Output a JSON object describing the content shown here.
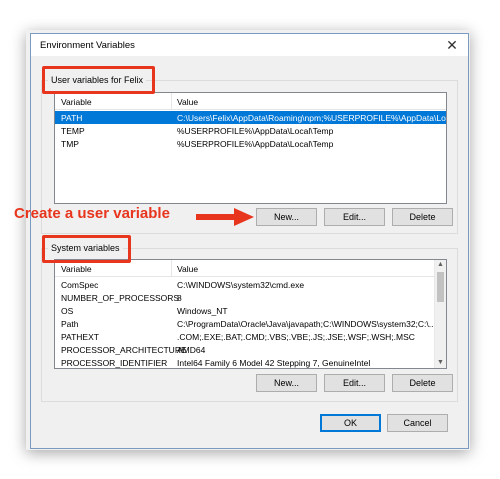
{
  "window": {
    "title": "Environment Variables",
    "close_glyph": "✕"
  },
  "user_group": {
    "label": "User variables for Felix",
    "columns": [
      "Variable",
      "Value"
    ],
    "rows": [
      {
        "variable": "PATH",
        "value": "C:\\Users\\Felix\\AppData\\Roaming\\npm;%USERPROFILE%\\AppData\\Lo...",
        "selected": true
      },
      {
        "variable": "TEMP",
        "value": "%USERPROFILE%\\AppData\\Local\\Temp",
        "selected": false
      },
      {
        "variable": "TMP",
        "value": "%USERPROFILE%\\AppData\\Local\\Temp",
        "selected": false
      }
    ],
    "buttons": {
      "new": "New...",
      "edit": "Edit...",
      "delete": "Delete"
    }
  },
  "system_group": {
    "label": "System variables",
    "columns": [
      "Variable",
      "Value"
    ],
    "rows": [
      {
        "variable": "ComSpec",
        "value": "C:\\WINDOWS\\system32\\cmd.exe"
      },
      {
        "variable": "NUMBER_OF_PROCESSORS",
        "value": "8"
      },
      {
        "variable": "OS",
        "value": "Windows_NT"
      },
      {
        "variable": "Path",
        "value": "C:\\ProgramData\\Oracle\\Java\\javapath;C:\\WINDOWS\\system32;C:\\..."
      },
      {
        "variable": "PATHEXT",
        "value": ".COM;.EXE;.BAT;.CMD;.VBS;.VBE;.JS;.JSE;.WSF;.WSH;.MSC"
      },
      {
        "variable": "PROCESSOR_ARCHITECTURE",
        "value": "AMD64"
      },
      {
        "variable": "PROCESSOR_IDENTIFIER",
        "value": "Intel64 Family 6 Model 42 Stepping 7, GenuineIntel"
      }
    ],
    "buttons": {
      "new": "New...",
      "edit": "Edit...",
      "delete": "Delete"
    }
  },
  "footer": {
    "ok": "OK",
    "cancel": "Cancel"
  },
  "annotation": {
    "text": "Create a user variable",
    "color": "#e8351d"
  },
  "colors": {
    "selection": "#0078d7",
    "callout": "#e8351d"
  }
}
